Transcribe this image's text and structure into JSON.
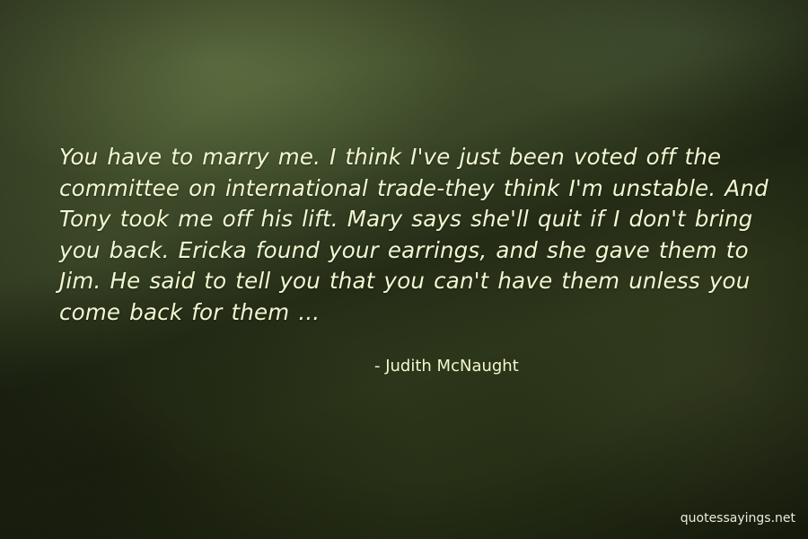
{
  "quote": {
    "text": "You have to marry me. I think I've just been voted off the committee on international trade-they think I'm unstable. And Tony took me off his lift. Mary says she'll quit if I don't bring you back. Ericka found your earrings, and she gave them to Jim. He said to tell you that you can't have them unless you come back for them ...",
    "author": "- Judith McNaught"
  },
  "watermark": {
    "text": "quotessayings.net"
  },
  "colors": {
    "text": "#f2f7d2",
    "background": "#2f3a1e"
  }
}
